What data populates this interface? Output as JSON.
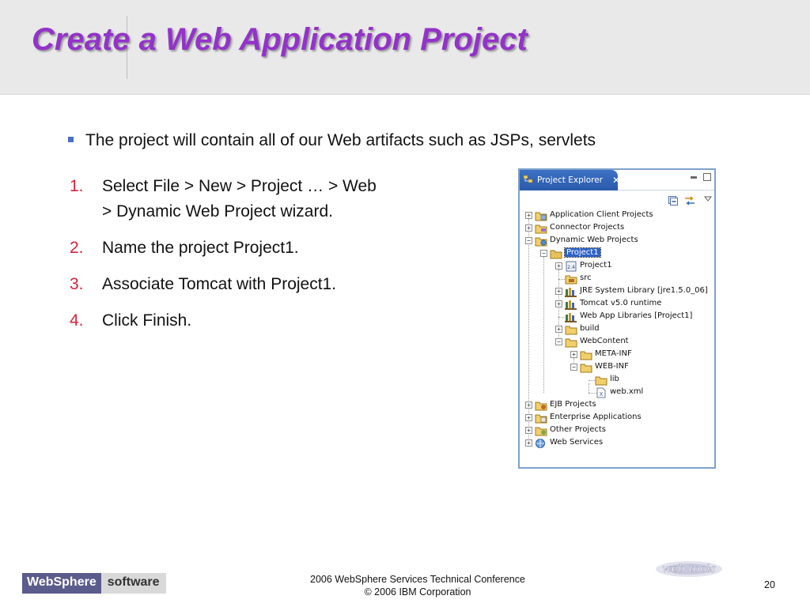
{
  "slide": {
    "title": "Create a Web Application Project",
    "bullet": "The project will contain all of our Web artifacts such as JSPs, servlets",
    "steps": [
      {
        "num": "1.",
        "line1": "Select File > New > Project … > Web",
        "line2": "> Dynamic Web Project wizard."
      },
      {
        "num": "2.",
        "line1": "Name the project Project1.",
        "line2": ""
      },
      {
        "num": "3.",
        "line1": "Associate Tomcat with Project1.",
        "line2": ""
      },
      {
        "num": "4.",
        "line1": "Click Finish.",
        "line2": ""
      }
    ]
  },
  "explorer": {
    "tab_label": "Project Explorer",
    "close_glyph": "✕",
    "tree": [
      {
        "label": "Application Client Projects",
        "expander": "+",
        "icon": "app-client-folder-icon"
      },
      {
        "label": "Connector Projects",
        "expander": "+",
        "icon": "connector-folder-icon"
      },
      {
        "label": "Dynamic Web Projects",
        "expander": "−",
        "icon": "web-projects-folder-icon"
      },
      {
        "label": "Project1",
        "expander": "−",
        "icon": "project-folder-icon",
        "selected": true
      },
      {
        "label": "Project1",
        "expander": "+",
        "icon": "deployment-descriptor-icon"
      },
      {
        "label": "src",
        "expander": "",
        "icon": "source-folder-icon"
      },
      {
        "label": "JRE System Library [jre1.5.0_06]",
        "expander": "+",
        "icon": "library-icon"
      },
      {
        "label": "Tomcat v5.0 runtime",
        "expander": "+",
        "icon": "library-icon"
      },
      {
        "label": "Web App Libraries [Project1]",
        "expander": "",
        "icon": "library-icon"
      },
      {
        "label": "build",
        "expander": "+",
        "icon": "folder-icon"
      },
      {
        "label": "WebContent",
        "expander": "−",
        "icon": "folder-icon"
      },
      {
        "label": "META-INF",
        "expander": "+",
        "icon": "folder-icon"
      },
      {
        "label": "WEB-INF",
        "expander": "−",
        "icon": "folder-icon"
      },
      {
        "label": "lib",
        "expander": "",
        "icon": "folder-icon"
      },
      {
        "label": "web.xml",
        "expander": "",
        "icon": "xml-file-icon"
      },
      {
        "label": "EJB Projects",
        "expander": "+",
        "icon": "ejb-folder-icon"
      },
      {
        "label": "Enterprise Applications",
        "expander": "+",
        "icon": "enterprise-folder-icon"
      },
      {
        "label": "Other Projects",
        "expander": "+",
        "icon": "other-folder-icon"
      },
      {
        "label": "Web Services",
        "expander": "+",
        "icon": "web-services-icon"
      }
    ]
  },
  "footer": {
    "brand_left": "WebSphere",
    "brand_right": "software",
    "conference_line1": "2006 WebSphere Services Technical Conference",
    "conference_line2": "© 2006 IBM Corporation",
    "page_number": "20",
    "webtools_logo": "web tools"
  },
  "colors": {
    "title": "#9333c9",
    "step_number": "#d6223a",
    "bullet": "#4c6fc4",
    "tab_blue": "#2f63c7",
    "panel_border": "#7ea1cc"
  }
}
